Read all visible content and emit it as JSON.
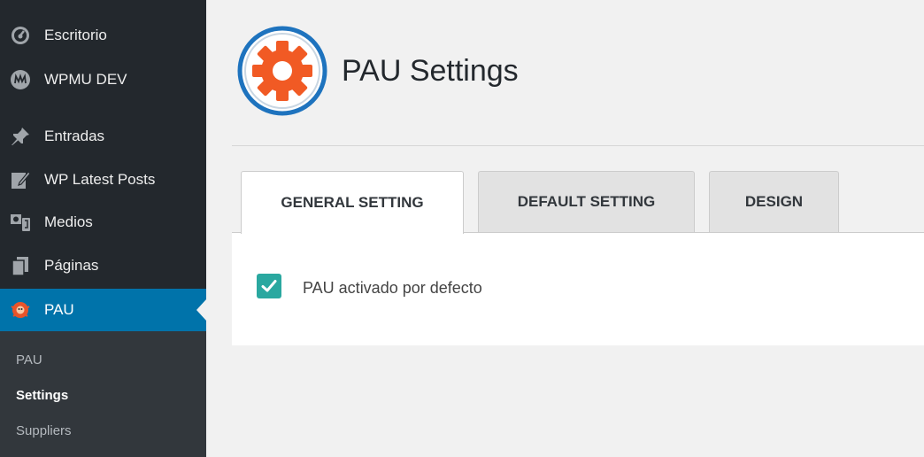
{
  "sidebar": {
    "items": [
      {
        "label": "Escritorio",
        "icon": "dashboard-icon"
      },
      {
        "label": "WPMU DEV",
        "icon": "wpmudev-icon"
      },
      {
        "label": "Entradas",
        "icon": "pin-icon"
      },
      {
        "label": "WP Latest Posts",
        "icon": "edit-icon"
      },
      {
        "label": "Medios",
        "icon": "media-icon"
      },
      {
        "label": "Páginas",
        "icon": "pages-icon"
      },
      {
        "label": "PAU",
        "icon": "pau-icon"
      }
    ],
    "active_index": 6,
    "submenu": [
      {
        "label": "PAU"
      },
      {
        "label": "Settings"
      },
      {
        "label": "Suppliers"
      }
    ],
    "current_submenu_index": 1
  },
  "header": {
    "title": "PAU Settings",
    "logo_icon": "gear-icon"
  },
  "tabs": [
    {
      "label": "GENERAL SETTING"
    },
    {
      "label": "DEFAULT SETTING"
    },
    {
      "label": "DESIGN"
    }
  ],
  "active_tab_index": 0,
  "settings": {
    "pau_default": {
      "label": "PAU activado por defecto",
      "checked": true
    }
  },
  "colors": {
    "sidebar_bg": "#23282d",
    "active_menu": "#0073aa",
    "checkbox": "#2aa8a0",
    "logo_gear": "#f15a24",
    "logo_ring": "#1e73be"
  }
}
